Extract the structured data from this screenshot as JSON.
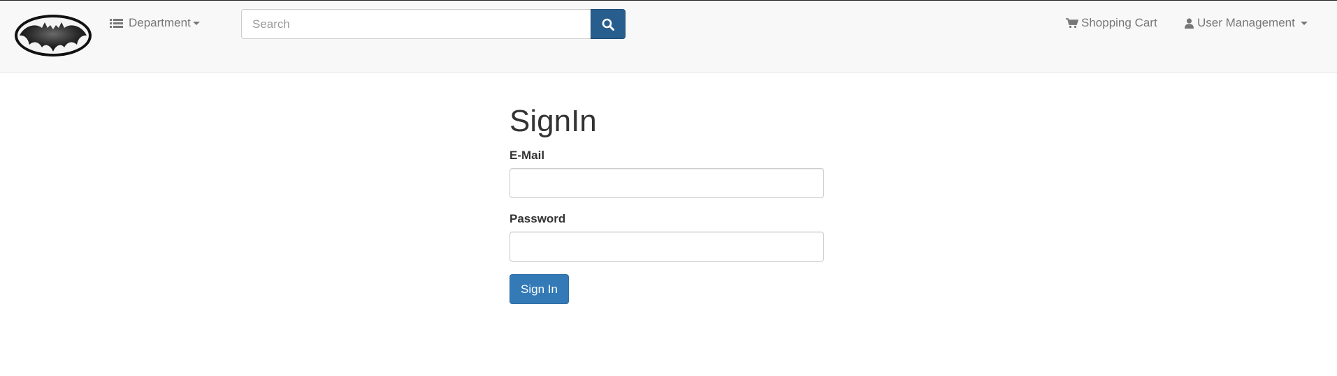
{
  "brand": {
    "logo": "bat-logo"
  },
  "nav": {
    "department_label": "Department",
    "department_icon": "list-icon",
    "search": {
      "placeholder": "Search",
      "value": "",
      "icon": "search-icon"
    },
    "cart_label": "Shopping Cart",
    "cart_icon": "shopping-cart-icon",
    "user_label": "User Management",
    "user_icon": "user-icon"
  },
  "signin": {
    "title": "SignIn",
    "email_label": "E-Mail",
    "email_value": "",
    "password_label": "Password",
    "password_value": "",
    "submit_label": "Sign In"
  },
  "colors": {
    "navbar_bg": "#f8f8f8",
    "search_button": "#285e8e",
    "primary_button": "#337ab7",
    "nav_text": "#777777"
  }
}
